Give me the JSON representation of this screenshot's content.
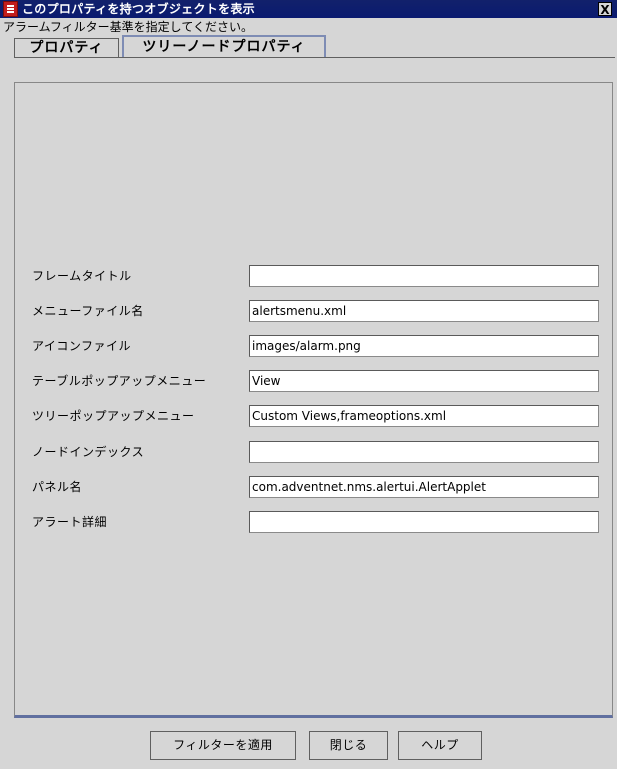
{
  "window": {
    "title": "このプロパティを持つオブジェクトを表示",
    "close_label": "X"
  },
  "instruction": "アラームフィルター基準を指定してください。",
  "tabs": [
    {
      "label": "プロパティ",
      "active": false
    },
    {
      "label": "ツリーノードプロパティ",
      "active": true
    }
  ],
  "fields": [
    {
      "label": "フレームタイトル",
      "value": ""
    },
    {
      "label": "メニューファイル名",
      "value": "alertsmenu.xml"
    },
    {
      "label": "アイコンファイル",
      "value": "images/alarm.png"
    },
    {
      "label": "テーブルポップアップメニュー",
      "value": "View"
    },
    {
      "label": "ツリーポップアップメニュー",
      "value": "Custom Views,frameoptions.xml"
    },
    {
      "label": "ノードインデックス",
      "value": ""
    },
    {
      "label": "パネル名",
      "value": "com.adventnet.nms.alertui.AlertApplet"
    },
    {
      "label": "アラート詳細",
      "value": ""
    }
  ],
  "buttons": {
    "apply": "フィルターを適用",
    "close": "閉じる",
    "help": "ヘルプ"
  }
}
